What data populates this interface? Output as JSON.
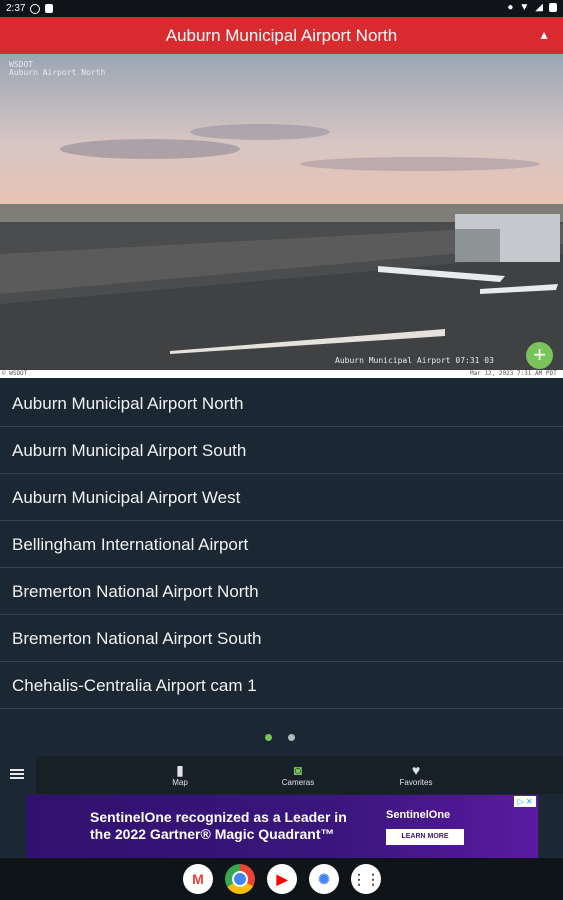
{
  "status_bar": {
    "time": "2:37"
  },
  "header": {
    "title": "Auburn Municipal Airport North"
  },
  "camera": {
    "overlay_top_line1": "WSDOT",
    "overlay_top_line2": "Auburn Airport North",
    "overlay_bottom_left": "© WSDOT",
    "overlay_bottom_center": "Auburn Municipal Airport  07:31  03",
    "overlay_bottom_right": "Mar 12, 2023 7:31 AM PDT"
  },
  "airports": [
    {
      "name": "Auburn Municipal Airport North"
    },
    {
      "name": "Auburn Municipal Airport South"
    },
    {
      "name": "Auburn Municipal Airport West"
    },
    {
      "name": "Bellingham International Airport"
    },
    {
      "name": "Bremerton National Airport North"
    },
    {
      "name": "Bremerton National Airport South"
    },
    {
      "name": "Chehalis-Centralia Airport cam 1"
    }
  ],
  "bottom_nav": {
    "map": {
      "label": "Map",
      "icon": "map-icon"
    },
    "cameras": {
      "label": "Cameras",
      "icon": "camera-icon"
    },
    "favorites": {
      "label": "Favorites",
      "icon": "heart-icon"
    }
  },
  "ad": {
    "line1": "SentinelOne recognized as a Leader in",
    "line2": "the 2022 Gartner® Magic Quadrant™",
    "brand": "SentinelOne",
    "cta": "LEARN MORE",
    "close": "▷ ✕"
  },
  "colors": {
    "header": "#d92a2f",
    "list_bg": "#1b2733",
    "active_dot": "#7ac25a",
    "fab": "#7ac25a"
  }
}
